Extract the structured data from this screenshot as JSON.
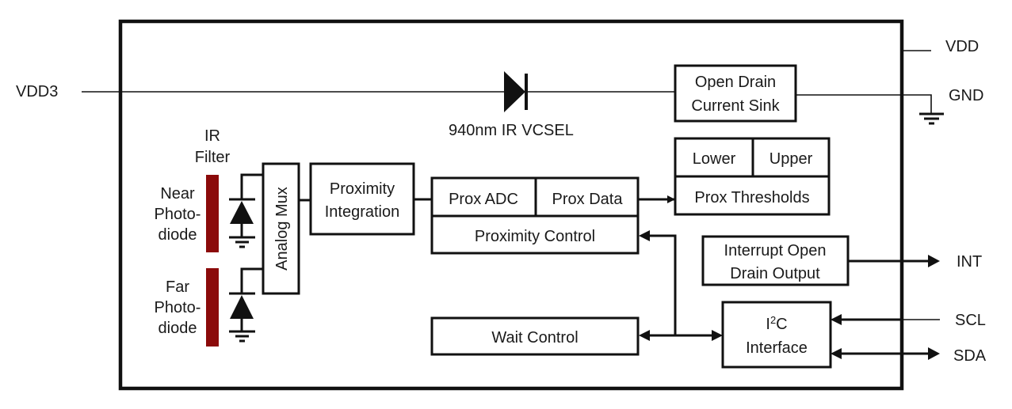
{
  "pins": {
    "vdd3": "VDD3",
    "vdd": "VDD",
    "gnd": "GND",
    "int": "INT",
    "scl": "SCL",
    "sda": "SDA"
  },
  "emitter": {
    "label": "940nm IR VCSEL"
  },
  "filter": {
    "line1": "IR",
    "line2": "Filter",
    "color": "#8B0A0A"
  },
  "photodiodes": {
    "near": {
      "line1": "Near",
      "line2": "Photo-",
      "line3": "diode"
    },
    "far": {
      "line1": "Far",
      "line2": "Photo-",
      "line3": "diode"
    }
  },
  "blocks": {
    "open_drain_sink": {
      "line1": "Open Drain",
      "line2": "Current Sink"
    },
    "analog_mux": {
      "label": "Analog Mux"
    },
    "prox_integration": {
      "line1": "Proximity",
      "line2": "Integration"
    },
    "prox_adc": {
      "label": "Prox ADC"
    },
    "prox_data": {
      "label": "Prox Data"
    },
    "prox_control": {
      "label": "Proximity Control"
    },
    "prox_thresholds": {
      "label": "Prox Thresholds",
      "lower": "Lower",
      "upper": "Upper"
    },
    "interrupt_output": {
      "line1": "Interrupt Open",
      "line2": "Drain Output"
    },
    "wait_control": {
      "label": "Wait Control"
    },
    "i2c_interface": {
      "line1_main": "I",
      "line1_sup": "2",
      "line1_tail": "C",
      "line2": "Interface"
    }
  }
}
